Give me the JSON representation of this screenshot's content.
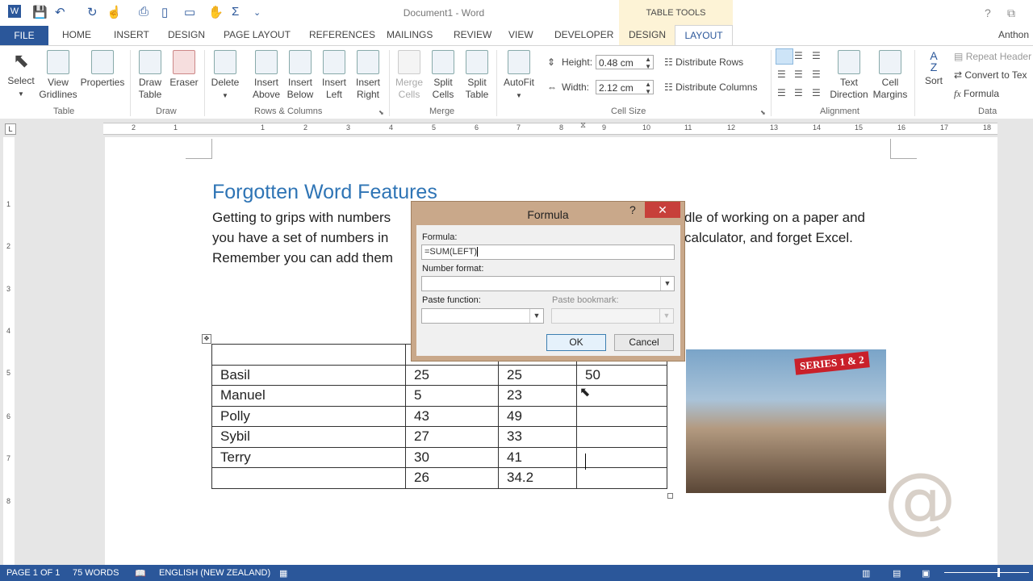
{
  "window": {
    "title": "Document1 - Word",
    "table_tools": "TABLE TOOLS",
    "help": "?",
    "restore": "⧉",
    "user": "Anthon"
  },
  "quick_access": {
    "word_icon": "W",
    "save_icon": "save-icon",
    "undo_icon": "undo-icon",
    "redo_icon": "redo-icon",
    "touch_icon": "touch-icon",
    "print_icon": "print-icon",
    "new_icon": "new-doc-icon",
    "table_icon": "table-icon",
    "hand_icon": "hand-icon",
    "sum_icon": "Σ",
    "more": "⌄"
  },
  "tabs": [
    "FILE",
    "HOME",
    "INSERT",
    "DESIGN",
    "PAGE LAYOUT",
    "REFERENCES",
    "MAILINGS",
    "REVIEW",
    "VIEW",
    "DEVELOPER",
    "DESIGN",
    "LAYOUT"
  ],
  "ribbon": {
    "table_group": {
      "label": "Table",
      "select": "Select",
      "view_gridlines_1": "View",
      "view_gridlines_2": "Gridlines",
      "properties": "Properties"
    },
    "draw_group": {
      "label": "Draw",
      "draw_table_1": "Draw",
      "draw_table_2": "Table",
      "eraser": "Eraser"
    },
    "rows_columns_group": {
      "label": "Rows & Columns",
      "delete": "Delete",
      "insert_above_1": "Insert",
      "insert_above_2": "Above",
      "insert_below_1": "Insert",
      "insert_below_2": "Below",
      "insert_left_1": "Insert",
      "insert_left_2": "Left",
      "insert_right_1": "Insert",
      "insert_right_2": "Right"
    },
    "merge_group": {
      "label": "Merge",
      "merge_cells_1": "Merge",
      "merge_cells_2": "Cells",
      "split_cells_1": "Split",
      "split_cells_2": "Cells",
      "split_table_1": "Split",
      "split_table_2": "Table"
    },
    "cell_size_group": {
      "label": "Cell Size",
      "autofit": "AutoFit",
      "height_label": "Height:",
      "height_value": "0.48 cm",
      "width_label": "Width:",
      "width_value": "2.12 cm",
      "distribute_rows": "Distribute Rows",
      "distribute_columns": "Distribute Columns"
    },
    "alignment_group": {
      "label": "Alignment",
      "text_direction_1": "Text",
      "text_direction_2": "Direction",
      "cell_margins_1": "Cell",
      "cell_margins_2": "Margins"
    },
    "data_group": {
      "label": "Data",
      "sort": "Sort",
      "repeat_header": "Repeat Header",
      "convert_to_text": "Convert to Tex",
      "formula": "Formula"
    }
  },
  "ruler": {
    "h_numbers": [
      "2",
      "1",
      "1",
      "2",
      "3",
      "4",
      "5",
      "6",
      "7",
      "8",
      "9",
      "10",
      "11",
      "12",
      "13",
      "14",
      "15",
      "16",
      "17",
      "18"
    ],
    "v_numbers": [
      "1",
      "2",
      "3",
      "4",
      "5",
      "6",
      "7",
      "8"
    ]
  },
  "document": {
    "heading": "Forgotten Word Features",
    "line1_left": "Getting to grips with numbers",
    "line1_right": "dle of working on a paper and",
    "line2_left": "you have a set of numbers in",
    "line2_right": "calculator, and forget Excel.",
    "line3_left": "Remember you can add them",
    "table": {
      "rows": [
        [
          "",
          "",
          "",
          ""
        ],
        [
          "Basil",
          "25",
          "25",
          "50"
        ],
        [
          "Manuel",
          "5",
          "23",
          ""
        ],
        [
          "Polly",
          "43",
          "49",
          ""
        ],
        [
          "Sybil",
          "27",
          "33",
          ""
        ],
        [
          "Terry",
          "30",
          "41",
          ""
        ],
        [
          "",
          "26",
          "34.2",
          ""
        ]
      ]
    },
    "photo_caption": "SERIES 1 & 2",
    "watermark": "@"
  },
  "dialog": {
    "title": "Formula",
    "help": "?",
    "close": "✕",
    "formula_label": "Formula:",
    "formula_value": "=SUM(LEFT)",
    "number_format_label": "Number format:",
    "number_format_value": "",
    "paste_function_label": "Paste function:",
    "paste_function_value": "",
    "paste_bookmark_label": "Paste bookmark:",
    "paste_bookmark_value": "",
    "ok": "OK",
    "cancel": "Cancel"
  },
  "status": {
    "page": "PAGE 1 OF 1",
    "words": "75 WORDS",
    "language": "ENGLISH (NEW ZEALAND)"
  },
  "colors": {
    "accent": "#2b579a",
    "table_tools": "#fdf3d6",
    "heading": "#2e74b5",
    "close": "#c7403a"
  }
}
